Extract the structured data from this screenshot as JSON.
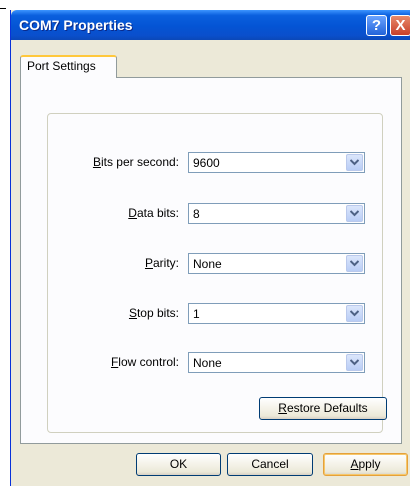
{
  "window": {
    "title": "COM7 Properties",
    "help_glyph": "?",
    "close_glyph": "X"
  },
  "tabs": [
    {
      "label": "Port Settings",
      "active": true
    }
  ],
  "settings": [
    {
      "key": "bits",
      "label_pre": "",
      "label_u": "B",
      "label_post": "its per second:",
      "value": "9600"
    },
    {
      "key": "data",
      "label_pre": "",
      "label_u": "D",
      "label_post": "ata bits:",
      "value": "8"
    },
    {
      "key": "parity",
      "label_pre": "",
      "label_u": "P",
      "label_post": "arity:",
      "value": "None"
    },
    {
      "key": "stop",
      "label_pre": "",
      "label_u": "S",
      "label_post": "top bits:",
      "value": "1"
    },
    {
      "key": "flow",
      "label_pre": "",
      "label_u": "F",
      "label_post": "low control:",
      "value": "None"
    }
  ],
  "buttons": {
    "restore_u": "R",
    "restore_rest": "estore Defaults",
    "ok": "OK",
    "cancel": "Cancel",
    "apply_u": "A",
    "apply_rest": "pply"
  },
  "colors": {
    "titlebar": "#0454d4",
    "dialog_bg": "#ece9d8",
    "tab_highlight": "#ffc83c"
  }
}
